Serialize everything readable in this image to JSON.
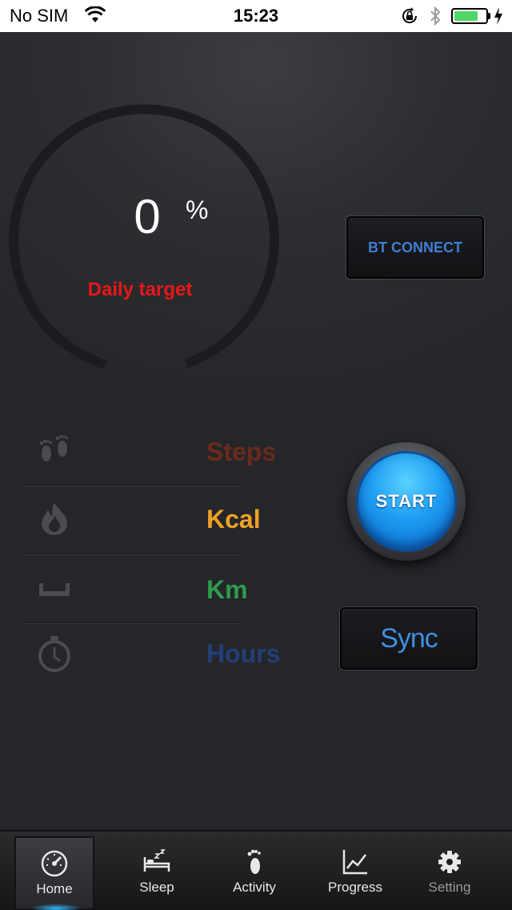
{
  "status_bar": {
    "carrier": "No SIM",
    "time": "15:23",
    "battery_level": 0.75,
    "icons": [
      "wifi-icon",
      "orientation-lock-icon",
      "bluetooth-icon",
      "battery-icon",
      "charging-icon"
    ]
  },
  "gauge": {
    "value": "0",
    "unit": "%",
    "caption": "Daily target",
    "caption_color": "#e8161a"
  },
  "buttons": {
    "bt_connect": "BT CONNECT",
    "start": "START",
    "sync": "Sync"
  },
  "stats": [
    {
      "icon": "footprints-icon",
      "label": "Steps",
      "color": "#6b2a1c"
    },
    {
      "icon": "flame-icon",
      "label": "Kcal",
      "color": "#f0a028"
    },
    {
      "icon": "distance-icon",
      "label": "Km",
      "color": "#2e9b4f"
    },
    {
      "icon": "stopwatch-icon",
      "label": "Hours",
      "color": "#233f78"
    }
  ],
  "tabs": [
    {
      "label": "Home",
      "icon": "speedometer-icon",
      "active": true
    },
    {
      "label": "Sleep",
      "icon": "bed-icon",
      "active": false
    },
    {
      "label": "Activity",
      "icon": "footprint-icon",
      "active": false
    },
    {
      "label": "Progress",
      "icon": "line-chart-icon",
      "active": false
    },
    {
      "label": "Setting",
      "icon": "gear-icon",
      "active": false
    }
  ]
}
